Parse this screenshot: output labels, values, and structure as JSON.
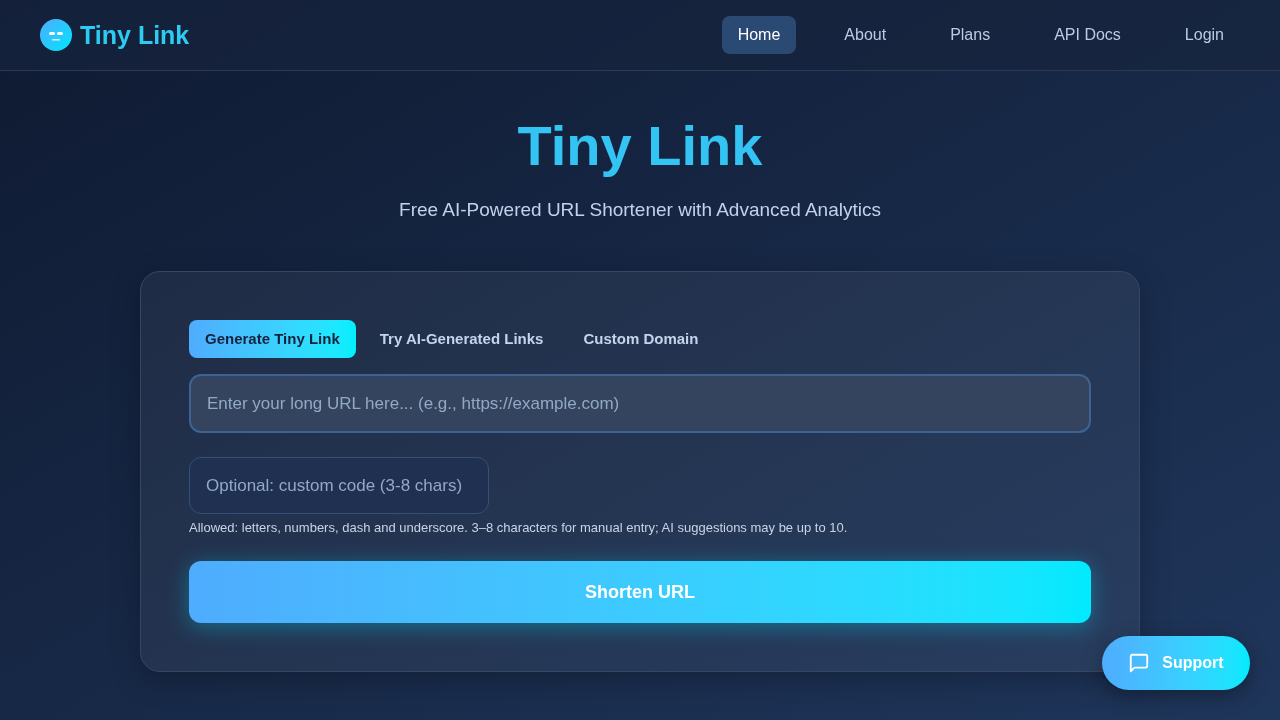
{
  "header": {
    "brand": "Tiny Link",
    "nav": [
      {
        "label": "Home",
        "selected": true
      },
      {
        "label": "About",
        "selected": false
      },
      {
        "label": "Plans",
        "selected": false
      },
      {
        "label": "API Docs",
        "selected": false
      },
      {
        "label": "Login",
        "selected": false
      }
    ]
  },
  "hero": {
    "title": "Tiny Link",
    "subtitle": "Free AI-Powered URL Shortener with Advanced Analytics"
  },
  "card": {
    "tabs": [
      {
        "label": "Generate Tiny Link",
        "selected": true
      },
      {
        "label": "Try AI-Generated Links",
        "selected": false
      },
      {
        "label": "Custom Domain",
        "selected": false
      }
    ],
    "url_field": {
      "placeholder": "Enter your long URL here... (e.g., https://example.com)"
    },
    "code_field": {
      "placeholder": "Optional: custom code (3-8 chars)"
    },
    "hint": "Allowed: letters, numbers, dash and underscore. 3–8 characters for manual entry; AI suggestions may be up to 10.",
    "submit_button": "Shorten URL"
  },
  "support_button": {
    "label": "Support"
  }
}
